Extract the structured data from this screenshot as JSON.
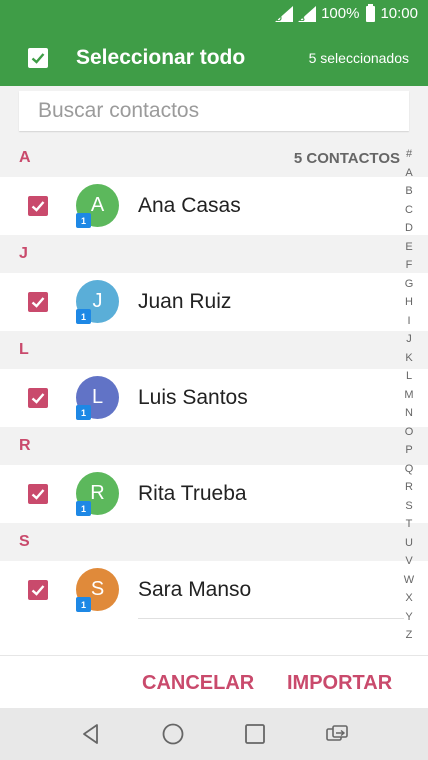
{
  "status_bar": {
    "signal1_label": "D",
    "signal2_label": "B",
    "battery": "100%",
    "time": "10:00"
  },
  "app_bar": {
    "title": "Seleccionar todo",
    "selected_count": "5 seleccionados",
    "select_all_checked": true
  },
  "search": {
    "placeholder": "Buscar contactos",
    "value": ""
  },
  "contacts_total": "5 CONTACTOS",
  "sections": [
    {
      "letter": "A",
      "contact": {
        "name": "Ana Casas",
        "initial": "A",
        "badge": "1",
        "color": "#5cb85c",
        "checked": true
      }
    },
    {
      "letter": "J",
      "contact": {
        "name": "Juan Ruiz",
        "initial": "J",
        "badge": "1",
        "color": "#5aaed8",
        "checked": true
      }
    },
    {
      "letter": "L",
      "contact": {
        "name": "Luis Santos",
        "initial": "L",
        "badge": "1",
        "color": "#6173c6",
        "checked": true
      }
    },
    {
      "letter": "R",
      "contact": {
        "name": "Rita Trueba",
        "initial": "R",
        "badge": "1",
        "color": "#5cb85c",
        "checked": true
      }
    },
    {
      "letter": "S",
      "contact": {
        "name": "Sara Manso",
        "initial": "S",
        "badge": "1",
        "color": "#e08a3a",
        "checked": true
      }
    }
  ],
  "alpha_index": [
    "#",
    "A",
    "B",
    "C",
    "D",
    "E",
    "F",
    "G",
    "H",
    "I",
    "J",
    "K",
    "L",
    "M",
    "N",
    "O",
    "P",
    "Q",
    "R",
    "S",
    "T",
    "U",
    "V",
    "W",
    "X",
    "Y",
    "Z"
  ],
  "actions": {
    "cancel_label": "CANCELAR",
    "import_label": "IMPORTAR"
  },
  "nav_icons": [
    "back-icon",
    "home-icon",
    "recents-icon",
    "switch-sim-icon"
  ],
  "colors": {
    "primary": "#3f9d47",
    "accent": "#c94a6c",
    "badge": "#1e88e5"
  }
}
